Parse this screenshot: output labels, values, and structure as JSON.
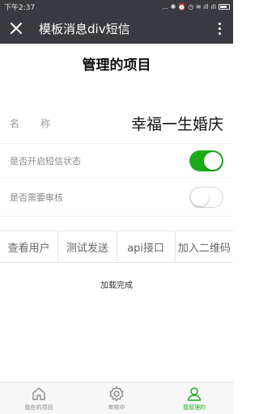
{
  "status_bar": {
    "time": "下午2:37",
    "indicators": "... ✱ ⏰ ◷ ≋ ıll ıll"
  },
  "header": {
    "title": "模板消息div短信"
  },
  "page_title": "管理的项目",
  "form": {
    "name_label_1": "名",
    "name_label_2": "称",
    "name_value": "幸福一生婚庆",
    "sms_toggle_label": "是否开启短信状态",
    "sms_toggle_on": true,
    "review_toggle_label": "是否需要审核",
    "review_toggle_on": false
  },
  "tabs": [
    "查看用户",
    "测试发送",
    "api接口",
    "加入二维码"
  ],
  "load_status": "加载完成",
  "bottom_nav": [
    {
      "label": "我在的项目",
      "icon": "home-icon"
    },
    {
      "label": "审核中",
      "icon": "gear-icon"
    },
    {
      "label": "我管理的",
      "icon": "user-icon",
      "active": true
    }
  ],
  "colors": {
    "header_bg": "#393a3f",
    "accent": "#1aad19"
  }
}
